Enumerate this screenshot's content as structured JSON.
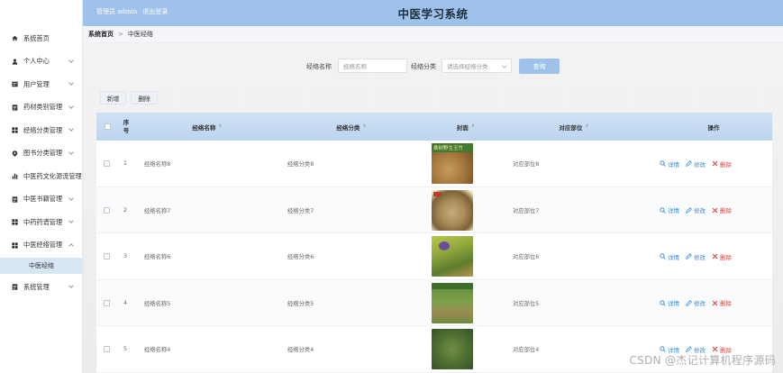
{
  "header": {
    "user_label": "管理员 admin",
    "logout_label": "退出登录",
    "title": "中医学习系统"
  },
  "sidebar": {
    "items": [
      {
        "label": "系统首页",
        "icon": "home-icon",
        "chevron": false
      },
      {
        "label": "个人中心",
        "icon": "person-icon",
        "chevron": true
      },
      {
        "label": "用户管理",
        "icon": "user-card-icon",
        "chevron": true
      },
      {
        "label": "药材类别管理",
        "icon": "document-icon",
        "chevron": true
      },
      {
        "label": "经络分类管理",
        "icon": "grid-icon",
        "chevron": true
      },
      {
        "label": "图书分类管理",
        "icon": "location-pin-icon",
        "chevron": true
      },
      {
        "label": "中医药文化源流管理",
        "icon": "bar-chart-icon",
        "chevron": false
      },
      {
        "label": "中医书籍管理",
        "icon": "document-icon",
        "chevron": true
      },
      {
        "label": "中药药谱管理",
        "icon": "grid-icon",
        "chevron": true
      },
      {
        "label": "中医经络管理",
        "icon": "grid-icon",
        "chevron": true,
        "expanded": true
      }
    ],
    "sub_item": "中医经络",
    "last_item": {
      "label": "系统管理",
      "icon": "document-icon",
      "chevron": true
    }
  },
  "breadcrumb": {
    "home": "系统首页",
    "separator": ">",
    "current": "中医经络"
  },
  "search": {
    "name_label": "经络名称",
    "name_placeholder": "经络名称",
    "category_label": "经络分类",
    "category_placeholder": "请选择经络分类",
    "query_button": "查询"
  },
  "toolbar": {
    "add_label": "新增",
    "delete_label": "删除"
  },
  "table": {
    "headers": {
      "index_line1": "序",
      "index_line2": "号",
      "name": "经络名称",
      "category": "经络分类",
      "cover": "封面",
      "part": "对应部位",
      "actions": "操作"
    },
    "action_labels": {
      "detail": "详情",
      "edit": "修改",
      "delete": "删除"
    },
    "rows": [
      {
        "index": "1",
        "name": "经络名称8",
        "category": "经络分类8",
        "part": "对应部位8",
        "cover_caption": "桑树野生玉竹",
        "cover_color": "#b5884b"
      },
      {
        "index": "2",
        "name": "经络名称7",
        "category": "经络分类7",
        "part": "对应部位7",
        "cover_caption": "",
        "cover_color": "#a78a5a"
      },
      {
        "index": "3",
        "name": "经络名称6",
        "category": "经络分类6",
        "part": "对应部位6",
        "cover_caption": "",
        "cover_color": "#8ca842"
      },
      {
        "index": "4",
        "name": "经络名称5",
        "category": "经络分类5",
        "part": "对应部位5",
        "cover_caption": "",
        "cover_color": "#6f9441"
      },
      {
        "index": "5",
        "name": "经络名称4",
        "category": "经络分类4",
        "part": "对应部位4",
        "cover_caption": "",
        "cover_color": "#5f7d3c"
      }
    ]
  },
  "watermark": "CSDN @杰记计算机程序源码",
  "colors": {
    "accent": "#9ec2e9",
    "table_header": "#c6dbf1",
    "link": "#3b8bd6",
    "danger": "#e0443e",
    "sub_active": "#d6e6f5"
  }
}
